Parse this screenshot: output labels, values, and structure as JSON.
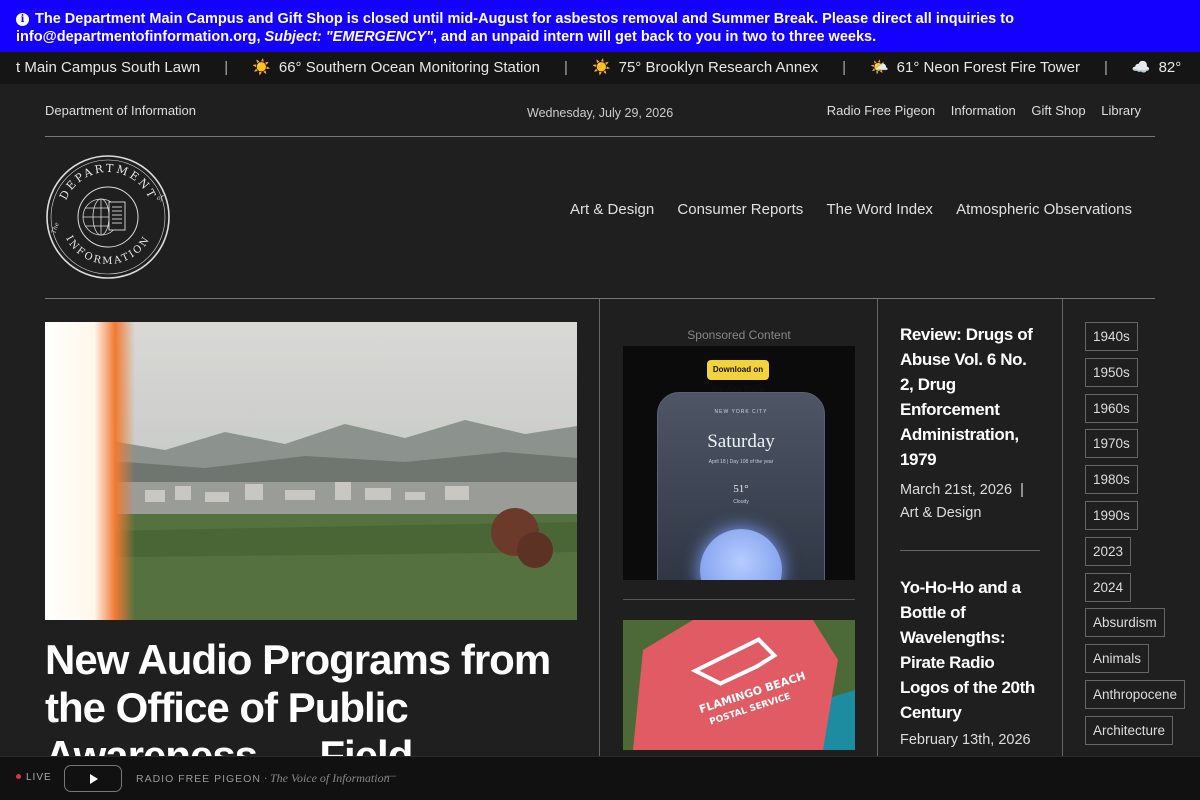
{
  "alert": {
    "text_before": "The Department Main Campus and Gift Shop is closed until mid-August for asbestos removal and Summer Break. Please direct all inquiries to info@departmentofinformation.org, ",
    "subject": "Subject: \"EMERGENCY\"",
    "text_after": ", and an unpaid intern will get back to you in two to three weeks."
  },
  "ticker": [
    {
      "icon": "",
      "text": "t Main Campus South Lawn"
    },
    {
      "icon": "☀️",
      "text": "66° Southern Ocean Monitoring Station"
    },
    {
      "icon": "☀️",
      "text": "75° Brooklyn Research Annex"
    },
    {
      "icon": "🌤️",
      "text": "61° Neon Forest Fire Tower"
    },
    {
      "icon": "☁️",
      "text": "82°"
    }
  ],
  "ticker_separator": "|",
  "topbar": {
    "site_name": "Department of Information",
    "date": "Wednesday, July 29, 2026",
    "links": [
      "Radio Free Pigeon",
      "Information",
      "Gift Shop",
      "Library"
    ]
  },
  "logo": {
    "top_text": "DEPARTMENT",
    "the_top": "The",
    "of": "of",
    "bottom_text": "INFORMATION"
  },
  "nav": [
    "Art & Design",
    "Consumer Reports",
    "The Word Index",
    "Atmospheric Observations"
  ],
  "hero": {
    "title": "New Audio Programs from the Office of Public Awareness — Field"
  },
  "sponsored": {
    "label": "Sponsored Content",
    "badge": "Download on the App Store",
    "city": "NEW YORK CITY",
    "day": "Saturday",
    "sub": "April 18  |  Day 108 of the year",
    "temp": "51°",
    "cond": "Cloudy"
  },
  "mid_photo": {
    "shirt_line1": "FLAMINGO BEACH",
    "shirt_line2": "POSTAL SERVICE"
  },
  "articles": [
    {
      "title": "Review: Drugs of Abuse Vol. 6 No. 2, Drug Enforcement Administration, 1979",
      "date": "March 21st, 2026",
      "sep": "|",
      "category": "Art & Design"
    },
    {
      "title": "Yo-Ho-Ho and a Bottle of Wavelengths: Pirate Radio Logos of the 20th Century",
      "date": "February 13th, 2026"
    }
  ],
  "tags": [
    "1940s",
    "1950s",
    "1960s",
    "1970s",
    "1980s",
    "1990s",
    "2023",
    "2024",
    "Absurdism",
    "Animals",
    "Anthropocene",
    "Architecture"
  ],
  "player": {
    "live": "LIVE",
    "station": "RADIO FREE PIGEON",
    "separator": " · ",
    "tagline": "The Voice of Information",
    "dash": "—"
  }
}
